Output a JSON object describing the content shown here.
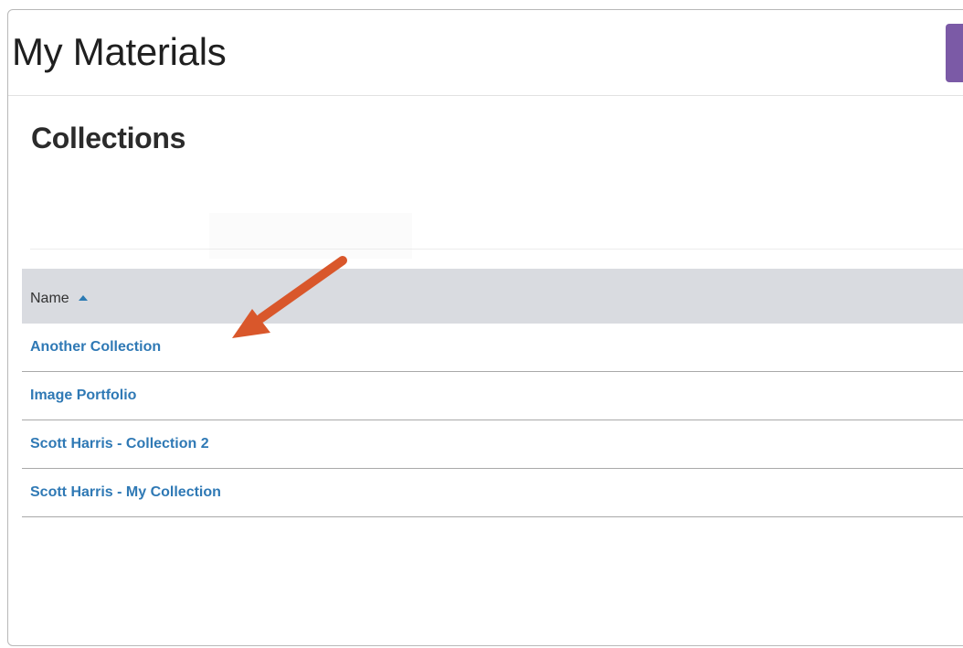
{
  "header": {
    "title": "My Materials"
  },
  "section": {
    "title": "Collections"
  },
  "table": {
    "columns": [
      {
        "label": "Name",
        "sort": "ascending"
      }
    ],
    "rows": [
      {
        "name": "Another Collection"
      },
      {
        "name": "Image Portfolio"
      },
      {
        "name": "Scott Harris - Collection 2"
      },
      {
        "name": "Scott Harris - My Collection"
      }
    ]
  },
  "colors": {
    "accent_purple": "#7b5aa6",
    "link_blue": "#2f79b5",
    "header_band": "#d9dbe0",
    "annotation_arrow": "#d9572b"
  },
  "icons": {
    "sort": "sort-ascending-icon",
    "annotation": "annotation-arrow-icon"
  }
}
